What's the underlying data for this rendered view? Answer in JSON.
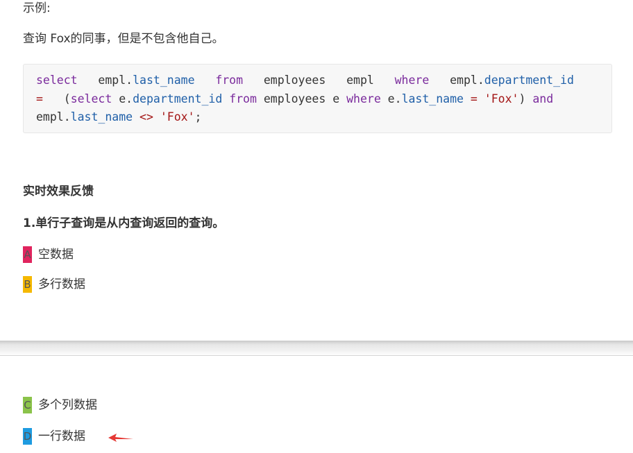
{
  "example_heading": "示例:",
  "description": "查询 Fox的同事，但是不包含他自己。",
  "code": {
    "line1": {
      "t1": "select",
      "t2": "   empl.",
      "t3": "last_name",
      "t4": "   ",
      "t5": "from",
      "t6": "   employees   empl   ",
      "t7": "where",
      "t8": "   empl.",
      "t9": "department_id"
    },
    "line2": {
      "t1": "=",
      "t2": "   (",
      "t3": "select",
      "t4": " e.",
      "t5": "department_id",
      "t6": " ",
      "t7": "from",
      "t8": " employees e ",
      "t9": "where",
      "t10": " e.",
      "t11": "last_name",
      "t12": " = ",
      "t13": "'Fox'",
      "t14": ") ",
      "t15": "and"
    },
    "line3": {
      "t1": "empl.",
      "t2": "last_name",
      "t3": " ",
      "t4": "<>",
      "t5": " ",
      "t6": "'Fox'",
      "t7": ";"
    }
  },
  "feedback_title": "实时效果反馈",
  "question": "1.单行子查询是从内查询返回的查询。",
  "options": [
    {
      "letter": "A",
      "text": "空数据",
      "color": "#e0245e"
    },
    {
      "letter": "B",
      "text": "多行数据",
      "color": "#f5b800"
    },
    {
      "letter": "C",
      "text": "多个列数据",
      "color": "#8bc34a"
    },
    {
      "letter": "D",
      "text": "一行数据",
      "color": "#1e9be0"
    }
  ],
  "arrow_color": "#e53935"
}
